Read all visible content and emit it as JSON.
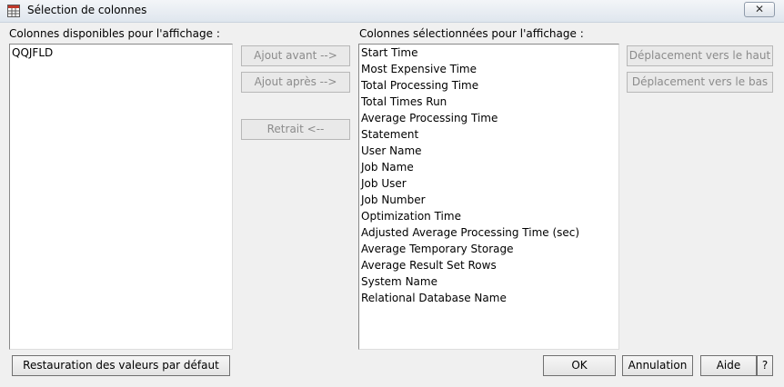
{
  "window": {
    "title": "Sélection de colonnes",
    "close_label": "✕"
  },
  "available": {
    "label": "Colonnes disponibles pour l'affichage :",
    "items": [
      "QQJFLD"
    ]
  },
  "selected": {
    "label": "Colonnes sélectionnées pour l'affichage :",
    "items": [
      "Start Time",
      "Most Expensive Time",
      "Total Processing Time",
      "Total Times Run",
      "Average Processing Time",
      "Statement",
      "User Name",
      "Job Name",
      "Job User",
      "Job Number",
      "Optimization Time",
      "Adjusted Average Processing Time (sec)",
      "Average Temporary Storage",
      "Average Result Set Rows",
      "System Name",
      "Relational Database Name"
    ]
  },
  "buttons": {
    "add_before": "Ajout avant -->",
    "add_after": "Ajout après -->",
    "remove": "Retrait <--",
    "move_up": "Déplacement vers le haut",
    "move_down": "Déplacement vers le bas",
    "restore": "Restauration des valeurs par défaut",
    "ok": "OK",
    "cancel": "Annulation",
    "help": "Aide",
    "help_q": "?"
  }
}
